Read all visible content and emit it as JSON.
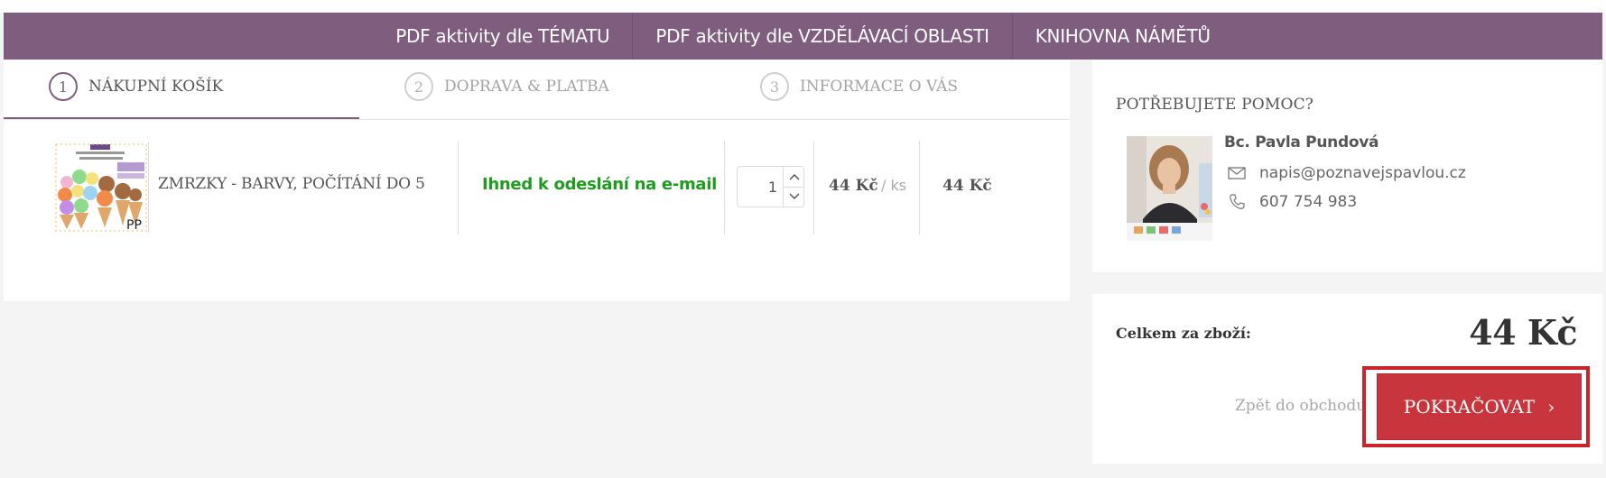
{
  "nav": {
    "items": [
      {
        "label": "PDF aktivity dle TÉMATU"
      },
      {
        "label": "PDF aktivity dle VZDĚLÁVACÍ OBLASTI"
      },
      {
        "label": "KNIHOVNA NÁMĚTŮ"
      }
    ]
  },
  "steps": [
    {
      "num": "1",
      "label": "NÁKUPNÍ KOŠÍK",
      "active": true
    },
    {
      "num": "2",
      "label": "DOPRAVA & PLATBA",
      "active": false
    },
    {
      "num": "3",
      "label": "INFORMACE O VÁS",
      "active": false
    }
  ],
  "cart": {
    "item": {
      "thumbnail_icon": "ice-cream-worksheet-thumbnail",
      "name": "ZMRZKY - BARVY, POČÍTÁNÍ DO 5",
      "availability": "Ihned k odeslání na e-mail",
      "quantity": "1",
      "unit_price": "44 Kč",
      "unit_label": "/ ks",
      "total_price": "44 Kč"
    }
  },
  "help": {
    "title": "POTŘEBUJETE POMOC?",
    "name": "Bc. Pavla Pundová",
    "email": "napis@poznavejspavlou.cz",
    "phone": "607 754 983"
  },
  "summary": {
    "label": "Celkem za zboží:",
    "value": "44 Kč",
    "back_link": "Zpět do obchodu",
    "continue_label": "POKRAČOVAT",
    "continue_chevron": "›"
  },
  "colors": {
    "brand": "#7f5d7e",
    "accent_button": "#c9353c",
    "availability_green": "#1e9c1e"
  }
}
